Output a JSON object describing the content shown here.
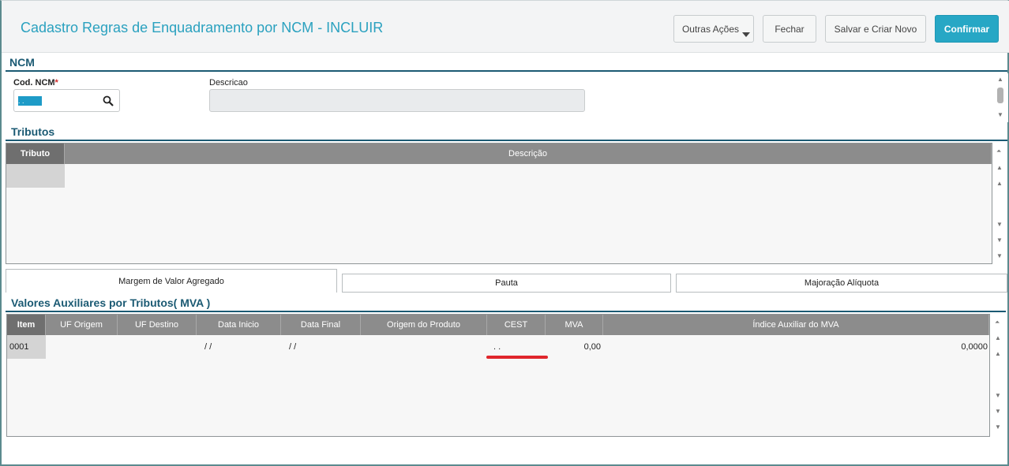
{
  "header": {
    "title": "Cadastro Regras de Enquadramento por NCM - INCLUIR",
    "buttons": {
      "outras_acoes": "Outras Ações",
      "fechar": "Fechar",
      "salvar_criar": "Salvar e Criar Novo",
      "confirmar": "Confirmar"
    }
  },
  "ncm": {
    "section_title": "NCM",
    "cod_label": "Cod. NCM",
    "required_mark": "*",
    "cod_value": " . .",
    "descricao_label": "Descricao",
    "descricao_value": ""
  },
  "tributos": {
    "section_title": "Tributos",
    "columns": [
      "Tributo",
      "Descrição"
    ]
  },
  "tabs": [
    "Margem de Valor Agregado",
    "Pauta",
    "Majoração Alíquota"
  ],
  "mva": {
    "section_title": "Valores Auxiliares por Tributos( MVA )",
    "columns": [
      "Item",
      "UF Origem",
      "UF Destino",
      "Data Inicio",
      "Data Final",
      "Origem do Produto",
      "CEST",
      "MVA",
      "Índice Auxiliar do MVA"
    ],
    "row": {
      "item": "0001",
      "uf_origem": "",
      "uf_destino": "",
      "data_inicio": "/ /",
      "data_final": "/ /",
      "origem_produto": "",
      "cest": ". .",
      "mva": "0,00",
      "indice": "0,0000"
    }
  },
  "colors": {
    "accent": "#27a7c5",
    "section": "#1b5a73",
    "annotation": "#e0262c"
  }
}
